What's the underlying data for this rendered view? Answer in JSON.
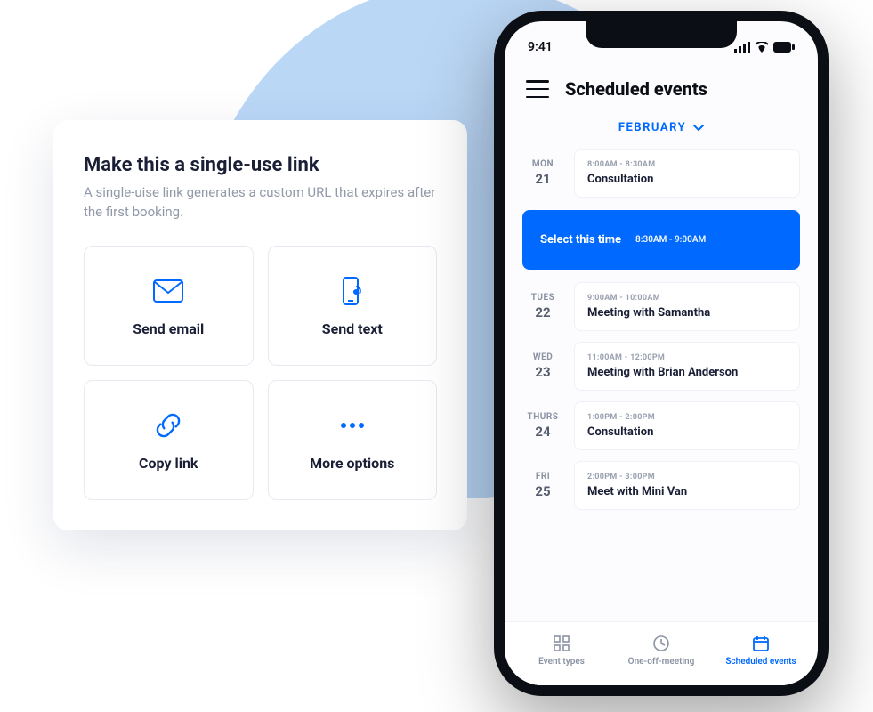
{
  "leftCard": {
    "title": "Make this a single-use link",
    "description": "A single-uise link generates a custom URL that expires after the first booking.",
    "actions": {
      "sendEmail": "Send email",
      "sendText": "Send text",
      "copyLink": "Copy link",
      "moreOptions": "More options"
    }
  },
  "phone": {
    "statusTime": "9:41",
    "headerTitle": "Scheduled events",
    "month": "FEBRUARY",
    "selectTime": {
      "label": "Select this time",
      "range": "8:30AM - 9:00AM"
    },
    "events": [
      {
        "weekday": "MON",
        "day": "21",
        "time": "8:00AM - 8:30AM",
        "name": "Consultation"
      },
      {
        "weekday": "TUES",
        "day": "22",
        "time": "9:00AM - 10:00AM",
        "name": "Meeting with Samantha"
      },
      {
        "weekday": "WED",
        "day": "23",
        "time": "11:00AM - 12:00PM",
        "name": "Meeting with Brian Anderson"
      },
      {
        "weekday": "THURS",
        "day": "24",
        "time": "1:00PM - 2:00PM",
        "name": "Consultation"
      },
      {
        "weekday": "FRI",
        "day": "25",
        "time": "2:00PM - 3:00PM",
        "name": "Meet with Mini Van"
      }
    ],
    "tabs": {
      "eventTypes": "Event types",
      "oneOff": "One-off-meeting",
      "scheduled": "Scheduled events"
    }
  }
}
